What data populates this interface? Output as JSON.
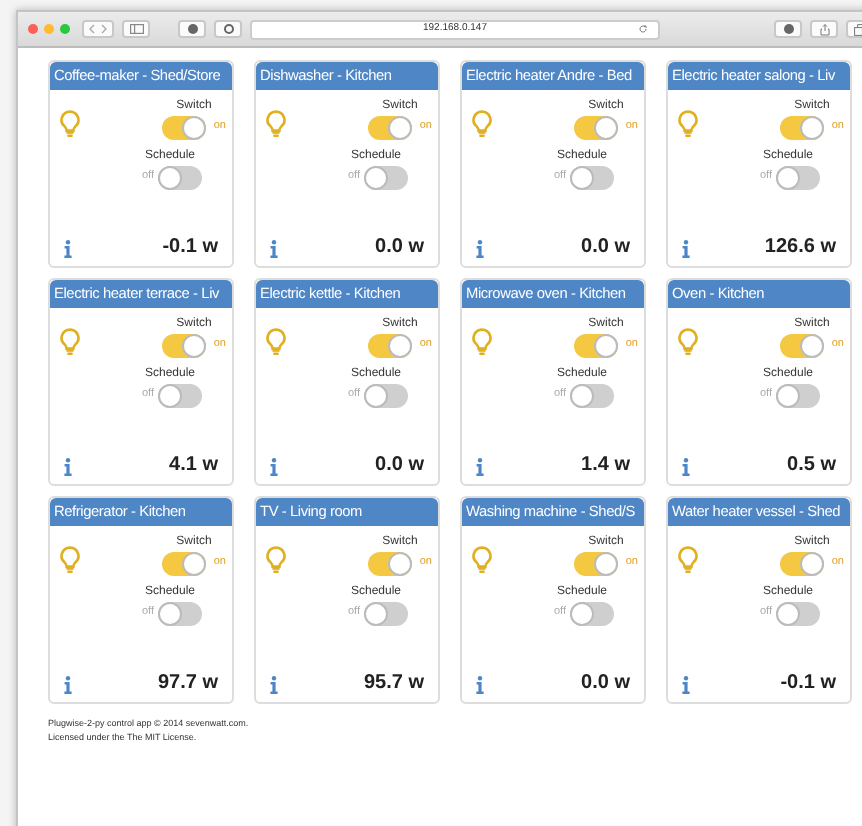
{
  "browser": {
    "url": "192.168.0.147"
  },
  "devices": [
    {
      "title": "Coffee-maker - Shed/Store",
      "switch": {
        "label": "Switch",
        "on": true,
        "state_text": "on"
      },
      "schedule": {
        "label": "Schedule",
        "on": false,
        "state_text": "off"
      },
      "power": "-0.1 w"
    },
    {
      "title": "Dishwasher - Kitchen",
      "switch": {
        "label": "Switch",
        "on": true,
        "state_text": "on"
      },
      "schedule": {
        "label": "Schedule",
        "on": false,
        "state_text": "off"
      },
      "power": "0.0 w"
    },
    {
      "title": "Electric heater Andre - Bed",
      "switch": {
        "label": "Switch",
        "on": true,
        "state_text": "on"
      },
      "schedule": {
        "label": "Schedule",
        "on": false,
        "state_text": "off"
      },
      "power": "0.0 w"
    },
    {
      "title": "Electric heater salong - Liv",
      "switch": {
        "label": "Switch",
        "on": true,
        "state_text": "on"
      },
      "schedule": {
        "label": "Schedule",
        "on": false,
        "state_text": "off"
      },
      "power": "126.6 w"
    },
    {
      "title": "Electric heater terrace - Liv",
      "switch": {
        "label": "Switch",
        "on": true,
        "state_text": "on"
      },
      "schedule": {
        "label": "Schedule",
        "on": false,
        "state_text": "off"
      },
      "power": "4.1 w"
    },
    {
      "title": "Electric kettle - Kitchen",
      "switch": {
        "label": "Switch",
        "on": true,
        "state_text": "on"
      },
      "schedule": {
        "label": "Schedule",
        "on": false,
        "state_text": "off"
      },
      "power": "0.0 w"
    },
    {
      "title": "Microwave oven - Kitchen",
      "switch": {
        "label": "Switch",
        "on": true,
        "state_text": "on"
      },
      "schedule": {
        "label": "Schedule",
        "on": false,
        "state_text": "off"
      },
      "power": "1.4 w"
    },
    {
      "title": "Oven - Kitchen",
      "switch": {
        "label": "Switch",
        "on": true,
        "state_text": "on"
      },
      "schedule": {
        "label": "Schedule",
        "on": false,
        "state_text": "off"
      },
      "power": "0.5 w"
    },
    {
      "title": "Refrigerator - Kitchen",
      "switch": {
        "label": "Switch",
        "on": true,
        "state_text": "on"
      },
      "schedule": {
        "label": "Schedule",
        "on": false,
        "state_text": "off"
      },
      "power": "97.7 w"
    },
    {
      "title": "TV - Living room",
      "switch": {
        "label": "Switch",
        "on": true,
        "state_text": "on"
      },
      "schedule": {
        "label": "Schedule",
        "on": false,
        "state_text": "off"
      },
      "power": "95.7 w"
    },
    {
      "title": "Washing machine - Shed/S",
      "switch": {
        "label": "Switch",
        "on": true,
        "state_text": "on"
      },
      "schedule": {
        "label": "Schedule",
        "on": false,
        "state_text": "off"
      },
      "power": "0.0 w"
    },
    {
      "title": "Water heater vessel - Shed",
      "switch": {
        "label": "Switch",
        "on": true,
        "state_text": "on"
      },
      "schedule": {
        "label": "Schedule",
        "on": false,
        "state_text": "off"
      },
      "power": "-0.1 w"
    }
  ],
  "footer": [
    "Plugwise-2-py control app © 2014 sevenwatt.com.",
    "Licensed under the The MIT License."
  ]
}
